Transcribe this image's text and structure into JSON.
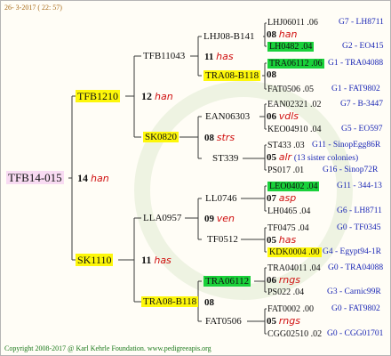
{
  "header": {
    "date": "26-  3-2017  ( 22: 57)"
  },
  "footer": {
    "copyright": "Copyright 2008-2017 @ Karl Kehrle Foundation.",
    "site": "www.pedigreeapis.org"
  },
  "gen0": {
    "name": "TFB14-015",
    "num": "14",
    "sub": "han"
  },
  "gen1": [
    {
      "name": "TFB1210",
      "num": "12",
      "sub": "han"
    },
    {
      "name": "SK1110",
      "num": "11",
      "sub": "has"
    }
  ],
  "gen2": [
    {
      "name": "TFB11043",
      "num": "11",
      "sub": "has"
    },
    {
      "name": "SK0820",
      "num": "08",
      "sub": "strs"
    },
    {
      "name": "LLA0957",
      "num": "09",
      "sub": "ven"
    },
    {
      "name": "TRA08-B118",
      "num": "08",
      "sub": ""
    }
  ],
  "gen3": [
    {
      "name": "LHJ08-B141",
      "num": "08",
      "sub": "han"
    },
    {
      "name": "TRA08-B118",
      "num": "",
      "sub": ""
    },
    {
      "name": "EAN06303",
      "num": "06",
      "sub": "vdls"
    },
    {
      "name": "ST339",
      "num": "05",
      "sub": "alr",
      "note": "(13 sister colonies)"
    },
    {
      "name": "LL0746",
      "num": "07",
      "sub": "asp"
    },
    {
      "name": "TF0512",
      "num": "05",
      "sub": "has"
    },
    {
      "name": "TRA06112",
      "num": "06",
      "sub": "rngs"
    },
    {
      "name": "FAT0506",
      "num": "05",
      "sub": "rngs"
    }
  ],
  "gen4": [
    {
      "name": "LHJ06011 .06",
      "ref": "G7 - LH8711"
    },
    {
      "name": "LH0482 .04",
      "ref": "G2 - EO415"
    },
    {
      "name": "TRA06112 .06",
      "ref": "G1 - TRA04088"
    },
    {
      "name": "FAT0506 .05",
      "ref": "G1 - FAT9802"
    },
    {
      "name": "EAN02321 .02",
      "ref": "G7 - B-3447"
    },
    {
      "name": "KEO04910 .04",
      "ref": "G5 - EO597"
    },
    {
      "name": "ST433 .03",
      "ref": "G11 - SinopEgg86R"
    },
    {
      "name": "PS017 .01",
      "ref": "G16 - Sinop72R"
    },
    {
      "name": "LEO0402 .04",
      "ref": "G11 - 344-13"
    },
    {
      "name": "LH0465 .04",
      "ref": "G6 - LH8711"
    },
    {
      "name": "TF0475 .04",
      "ref": "G0 - TF0345"
    },
    {
      "name": "KDK0004 .00",
      "ref": "G4 - Egypt94-1R"
    },
    {
      "name": "TRA04011 .04",
      "ref": "G0 - TRA04088"
    },
    {
      "name": "PS022 .04",
      "ref": "G3 - Carnic99R"
    },
    {
      "name": "FAT0002 .00",
      "ref": "G0 - FAT9802"
    },
    {
      "name": "CGG02510 .02",
      "ref": "G0 - CGG01701"
    }
  ],
  "colors": {
    "yellow": "#fdf70a",
    "pink": "#f8dbf2",
    "green": "#19d13a",
    "red": "#d01010",
    "blue": "#1b27b5"
  }
}
